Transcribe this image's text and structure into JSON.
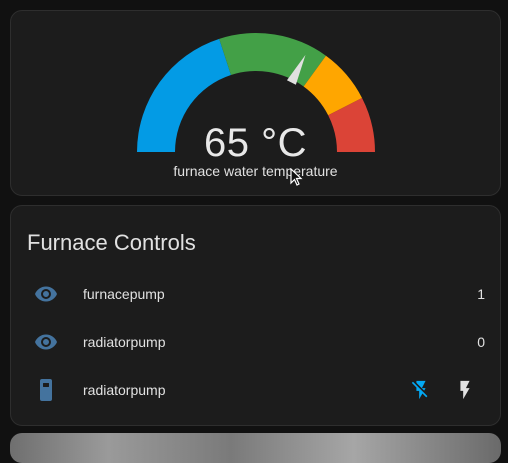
{
  "gauge": {
    "value_text": "65 °C",
    "value": 65,
    "min": 0,
    "max": 100,
    "name": "furnace water temperature",
    "severity_colors": {
      "blue": "#039be5",
      "green": "#43a047",
      "orange": "#ffa600",
      "red": "#db4437"
    },
    "severity_bands": [
      {
        "from": 0,
        "to": 40,
        "color": "#039be5"
      },
      {
        "from": 40,
        "to": 70,
        "color": "#43a047"
      },
      {
        "from": 70,
        "to": 85,
        "color": "#ffa600"
      },
      {
        "from": 85,
        "to": 100,
        "color": "#db4437"
      }
    ],
    "needle_color": "#e0e0e0"
  },
  "controls": {
    "title": "Furnace Controls",
    "rows": [
      {
        "icon": "eye-icon",
        "label": "furnacepump",
        "value": "1"
      },
      {
        "icon": "eye-icon",
        "label": "radiatorpump",
        "value": "0"
      },
      {
        "icon": "phone-battery-icon",
        "label": "radiatorpump",
        "buttons": [
          "flash-off-icon",
          "flash-icon"
        ]
      }
    ],
    "accent_color": "#44739e",
    "active_color": "#03a9f4"
  }
}
